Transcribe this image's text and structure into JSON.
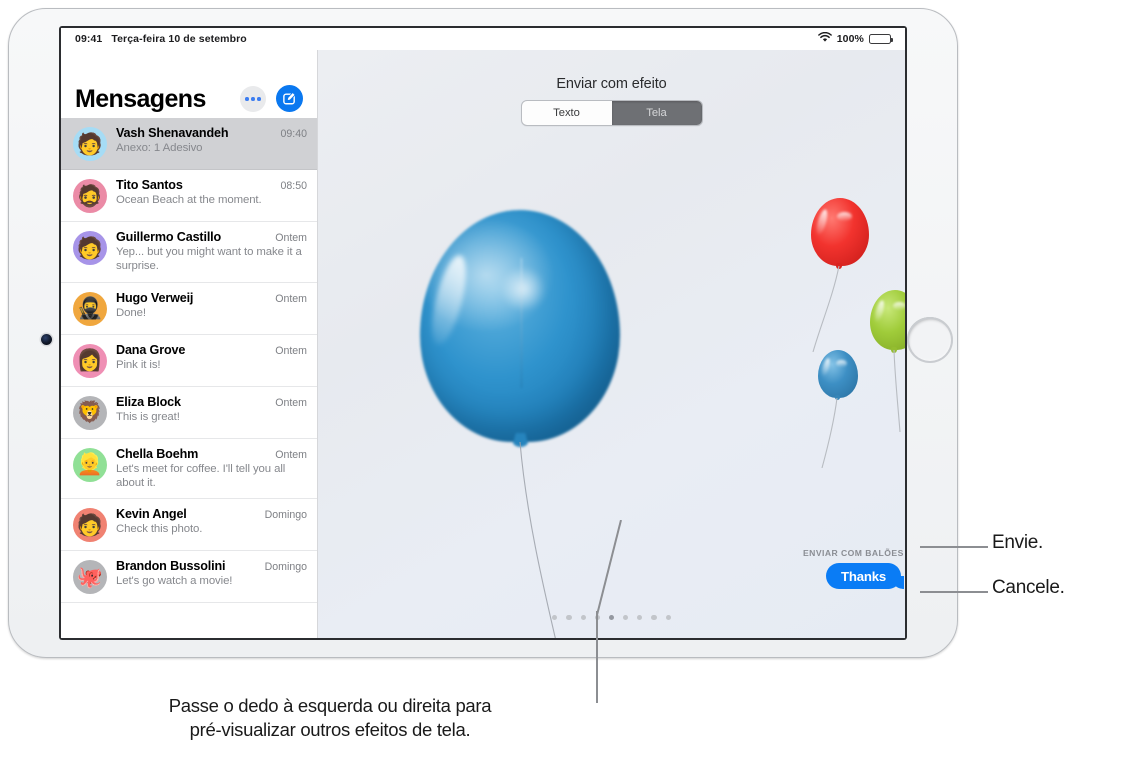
{
  "status_bar": {
    "time": "09:41",
    "date": "Terça-feira 10 de setembro",
    "wifi_icon": "wifi-icon",
    "battery_percent": "100%",
    "battery_icon": "battery-full-icon"
  },
  "sidebar": {
    "title": "Mensagens",
    "more_button": "more-button",
    "compose_button": "compose-button",
    "conversations": [
      {
        "name": "Vash Shenavandeh",
        "time": "09:40",
        "preview": "Anexo: 1 Adesivo",
        "avatar": "🧑",
        "avatar_bg": "#a6dcf5",
        "selected": true
      },
      {
        "name": "Tito Santos",
        "time": "08:50",
        "preview": "Ocean Beach at the moment.",
        "avatar": "🧔",
        "avatar_bg": "#eb8ba6",
        "selected": false
      },
      {
        "name": "Guillermo Castillo",
        "time": "Ontem",
        "preview": "Yep... but you might want to make it a surprise.",
        "avatar": "🧑",
        "avatar_bg": "#a794e8",
        "selected": false
      },
      {
        "name": "Hugo Verweij",
        "time": "Ontem",
        "preview": "Done!",
        "avatar": "🥷",
        "avatar_bg": "#f0a73e",
        "selected": false
      },
      {
        "name": "Dana Grove",
        "time": "Ontem",
        "preview": "Pink it is!",
        "avatar": "👩",
        "avatar_bg": "#ef8fb4",
        "selected": false
      },
      {
        "name": "Eliza Block",
        "time": "Ontem",
        "preview": "This is great!",
        "avatar": "🦁",
        "avatar_bg": "#b4b5b8",
        "selected": false
      },
      {
        "name": "Chella Boehm",
        "time": "Ontem",
        "preview": "Let's meet for coffee. I'll tell you all about it.",
        "avatar": "👱",
        "avatar_bg": "#90e096",
        "selected": false
      },
      {
        "name": "Kevin Angel",
        "time": "Domingo",
        "preview": "Check this photo.",
        "avatar": "🧑",
        "avatar_bg": "#f08272",
        "selected": false
      },
      {
        "name": "Brandon Bussolini",
        "time": "Domingo",
        "preview": "Let's go watch a movie!",
        "avatar": "🐙",
        "avatar_bg": "#b4b5b8",
        "selected": false
      }
    ]
  },
  "effect_pane": {
    "title": "Enviar com efeito",
    "segments": [
      {
        "label": "Texto",
        "active": false
      },
      {
        "label": "Tela",
        "active": true
      }
    ],
    "effect_name": "ENVIAR COM BALÕES",
    "message_text": "Thanks",
    "send_button": "send-arrow-up-icon",
    "cancel_button": "cancel-x-icon",
    "page_dots_total": 9,
    "page_dots_active_index": 4,
    "balloon_colors": {
      "main": "#2f93cd",
      "red": "#f2332e",
      "green": "#a0cc3a",
      "blue": "#3d8fc4"
    }
  },
  "callouts": {
    "send": "Envie.",
    "cancel": "Cancele.",
    "caption_line1": "Passe o dedo à esquerda ou direita para",
    "caption_line2": "pré-visualizar outros efeitos de tela."
  }
}
